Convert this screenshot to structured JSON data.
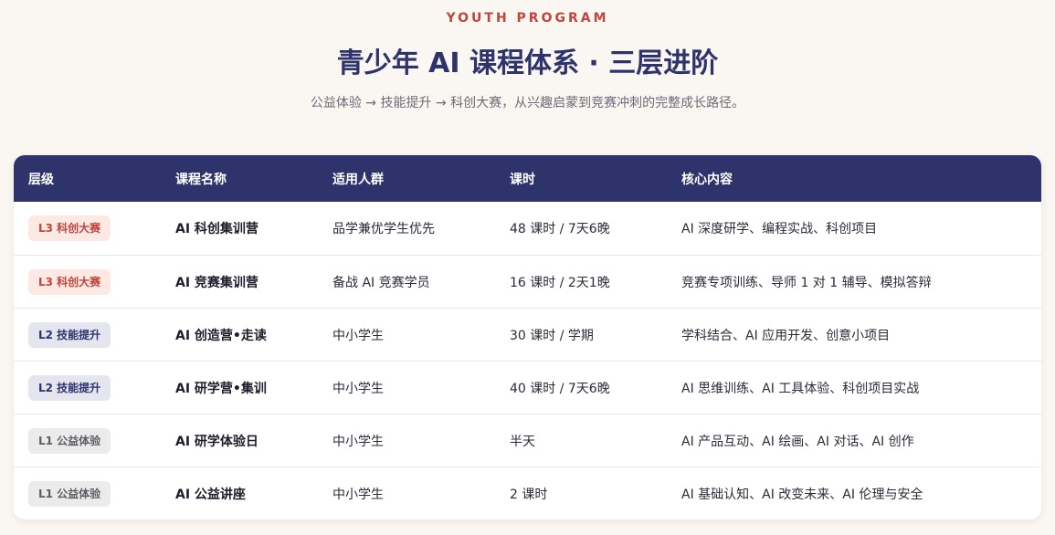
{
  "header": {
    "eyebrow": "YOUTH PROGRAM",
    "title": "青少年 AI 课程体系 · 三层进阶",
    "subtitle": "公益体验 → 技能提升 → 科创大赛，从兴趣启蒙到竞赛冲刺的完整成长路径。"
  },
  "table": {
    "columns": [
      "层级",
      "课程名称",
      "适用人群",
      "课时",
      "核心内容"
    ],
    "rows": [
      {
        "level": "L3 科创大赛",
        "tier": "l3",
        "course": "AI 科创集训营",
        "audience": "品学兼优学生优先",
        "hours": "48 课时 / 7天6晚",
        "content": "AI 深度研学、编程实战、科创项目"
      },
      {
        "level": "L3 科创大赛",
        "tier": "l3",
        "course": "AI 竞赛集训营",
        "audience": "备战 AI 竞赛学员",
        "hours": "16 课时 / 2天1晚",
        "content": "竞赛专项训练、导师 1 对 1 辅导、模拟答辩"
      },
      {
        "level": "L2 技能提升",
        "tier": "l2",
        "course": "AI 创造营•走读",
        "audience": "中小学生",
        "hours": "30 课时 / 学期",
        "content": "学科结合、AI 应用开发、创意小项目"
      },
      {
        "level": "L2 技能提升",
        "tier": "l2",
        "course": "AI 研学营•集训",
        "audience": "中小学生",
        "hours": "40 课时 / 7天6晚",
        "content": "AI 思维训练、AI 工具体验、科创项目实战"
      },
      {
        "level": "L1 公益体验",
        "tier": "l1",
        "course": "AI 研学体验日",
        "audience": "中小学生",
        "hours": "半天",
        "content": "AI 产品互动、AI 绘画、AI 对话、AI 创作"
      },
      {
        "level": "L1 公益体验",
        "tier": "l1",
        "course": "AI 公益讲座",
        "audience": "中小学生",
        "hours": "2 课时",
        "content": "AI 基础认知、AI 改变未来、AI 伦理与安全"
      }
    ]
  },
  "colors": {
    "navy": "#2e336b",
    "accent_red": "#c0453d",
    "background": "#faf6f1"
  }
}
